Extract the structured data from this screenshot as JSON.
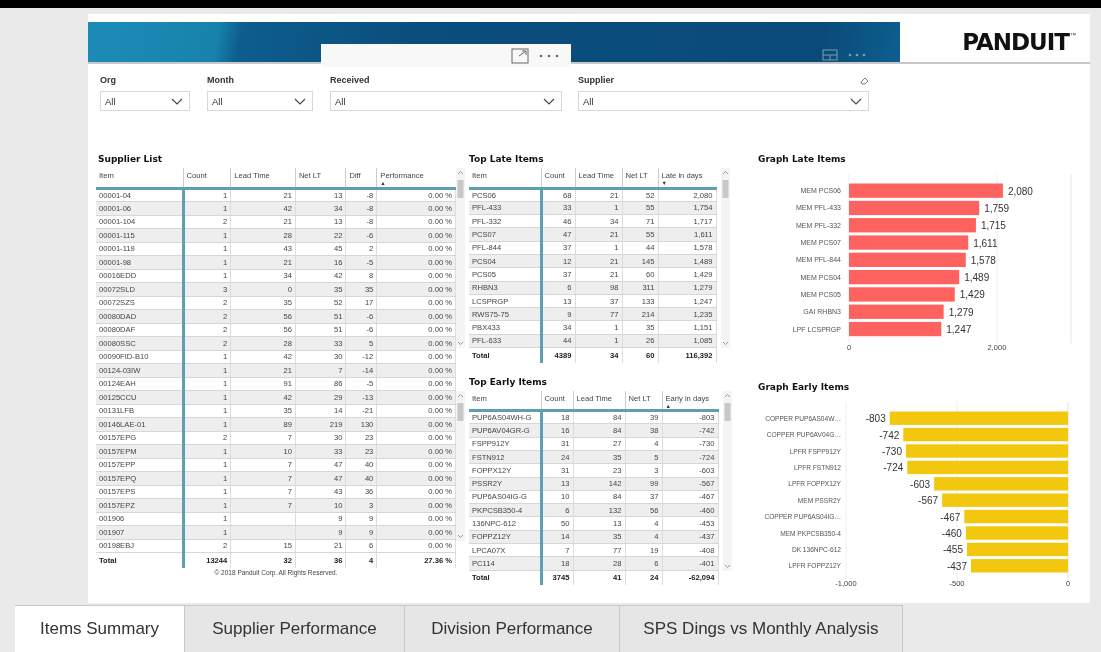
{
  "logo": "PANDUIT",
  "logo_mark": "™",
  "filters": [
    {
      "label": "Org",
      "value": "All"
    },
    {
      "label": "Month",
      "value": "All"
    },
    {
      "label": "Received",
      "value": "All"
    },
    {
      "label": "Supplier",
      "value": "All",
      "eraser": true
    }
  ],
  "supplier_list": {
    "title": "Supplier List",
    "columns": [
      {
        "label": "Item"
      },
      {
        "label": "Count"
      },
      {
        "label": "Lead Time"
      },
      {
        "label": "Net LT"
      },
      {
        "label": "Diff"
      },
      {
        "label": "Performance",
        "sort_arrow": "▲"
      }
    ],
    "rows": [
      [
        "00001-04",
        "1",
        "21",
        "13",
        "-8",
        "0.00 %"
      ],
      [
        "00001-06",
        "1",
        "42",
        "34",
        "-8",
        "0.00 %"
      ],
      [
        "00001-104",
        "2",
        "21",
        "13",
        "-8",
        "0.00 %"
      ],
      [
        "00001-115",
        "1",
        "28",
        "22",
        "-6",
        "0.00 %"
      ],
      [
        "00001-119",
        "1",
        "43",
        "45",
        "2",
        "0.00 %"
      ],
      [
        "00001-98",
        "1",
        "21",
        "16",
        "-5",
        "0.00 %"
      ],
      [
        "00016EDD",
        "1",
        "34",
        "42",
        "8",
        "0.00 %"
      ],
      [
        "00072SLD",
        "3",
        "0",
        "35",
        "35",
        "0.00 %"
      ],
      [
        "00072SZS",
        "2",
        "35",
        "52",
        "17",
        "0.00 %"
      ],
      [
        "00080DAD",
        "2",
        "56",
        "51",
        "-6",
        "0.00 %"
      ],
      [
        "00080DAF",
        "2",
        "56",
        "51",
        "-6",
        "0.00 %"
      ],
      [
        "00080SSC",
        "2",
        "28",
        "33",
        "5",
        "0.00 %"
      ],
      [
        "00090FID-B10",
        "1",
        "42",
        "30",
        "-12",
        "0.00 %"
      ],
      [
        "00124-03IW",
        "1",
        "21",
        "7",
        "-14",
        "0.00 %"
      ],
      [
        "00124EAH",
        "1",
        "91",
        "86",
        "-5",
        "0.00 %"
      ],
      [
        "00125CCU",
        "1",
        "42",
        "29",
        "-13",
        "0.00 %"
      ],
      [
        "00131LFB",
        "1",
        "35",
        "14",
        "-21",
        "0.00 %"
      ],
      [
        "00146LAE-01",
        "1",
        "89",
        "219",
        "130",
        "0.00 %"
      ],
      [
        "00157EPG",
        "2",
        "7",
        "30",
        "23",
        "0.00 %"
      ],
      [
        "00157EPM",
        "1",
        "10",
        "33",
        "23",
        "0.00 %"
      ],
      [
        "00157EPP",
        "1",
        "7",
        "47",
        "40",
        "0.00 %"
      ],
      [
        "00157EPQ",
        "1",
        "7",
        "47",
        "40",
        "0.00 %"
      ],
      [
        "00157EPS",
        "1",
        "7",
        "43",
        "36",
        "0.00 %"
      ],
      [
        "00157EPZ",
        "1",
        "7",
        "10",
        "3",
        "0.00 %"
      ],
      [
        "001906",
        "1",
        "",
        "9",
        "9",
        "0.00 %"
      ],
      [
        "001907",
        "1",
        "",
        "9",
        "9",
        "0.00 %"
      ],
      [
        "00198EBJ",
        "2",
        "15",
        "21",
        "6",
        "0.00 %"
      ]
    ],
    "total": [
      "Total",
      "13244",
      "32",
      "36",
      "4",
      "27.36 %"
    ]
  },
  "footer": "© 2018 Panduit Corp.  All Rights Reserved.",
  "top_late": {
    "title": "Top Late Items",
    "columns": [
      {
        "label": "Item"
      },
      {
        "label": "Count"
      },
      {
        "label": "Lead Time"
      },
      {
        "label": "Net LT"
      },
      {
        "label": "Late in days",
        "sort_arrow": "▼"
      }
    ],
    "rows": [
      [
        "PCS06",
        "68",
        "21",
        "52",
        "2,080"
      ],
      [
        "PFL-433",
        "33",
        "1",
        "55",
        "1,754"
      ],
      [
        "PFL-332",
        "46",
        "34",
        "71",
        "1,717"
      ],
      [
        "PCS07",
        "47",
        "21",
        "55",
        "1,611"
      ],
      [
        "PFL-844",
        "37",
        "1",
        "44",
        "1,578"
      ],
      [
        "PCS04",
        "12",
        "21",
        "145",
        "1,489"
      ],
      [
        "PCS05",
        "37",
        "21",
        "60",
        "1,429"
      ],
      [
        "RHBN3",
        "6",
        "98",
        "311",
        "1,279"
      ],
      [
        "LCSPRGP",
        "13",
        "37",
        "133",
        "1,247"
      ],
      [
        "RWS75-75",
        "9",
        "77",
        "214",
        "1,235"
      ],
      [
        "PBX433",
        "34",
        "1",
        "35",
        "1,151"
      ],
      [
        "PFL-633",
        "44",
        "1",
        "26",
        "1,085"
      ]
    ],
    "total": [
      "Total",
      "4389",
      "34",
      "60",
      "116,392"
    ]
  },
  "top_early": {
    "title": "Top Early Items",
    "columns": [
      {
        "label": "Item"
      },
      {
        "label": "Count"
      },
      {
        "label": "Lead Time"
      },
      {
        "label": "Net LT"
      },
      {
        "label": "Early in days",
        "sort_arrow": "▲"
      }
    ],
    "rows": [
      [
        "PUP6AS04WH-G",
        "18",
        "84",
        "39",
        "-803"
      ],
      [
        "PUP6AV04GR-G",
        "16",
        "84",
        "38",
        "-742"
      ],
      [
        "FSPP912Y",
        "31",
        "27",
        "4",
        "-730"
      ],
      [
        "FSTN912",
        "24",
        "35",
        "5",
        "-724"
      ],
      [
        "FOPPX12Y",
        "31",
        "23",
        "3",
        "-603"
      ],
      [
        "PSSR2Y",
        "13",
        "142",
        "99",
        "-567"
      ],
      [
        "PUP6AS04IG-G",
        "10",
        "84",
        "37",
        "-467"
      ],
      [
        "PKPCSB350-4",
        "6",
        "132",
        "56",
        "-460"
      ],
      [
        "136NPC-612",
        "50",
        "13",
        "4",
        "-453"
      ],
      [
        "FOPPZ12Y",
        "14",
        "35",
        "4",
        "-437"
      ],
      [
        "LPCA07X",
        "7",
        "77",
        "19",
        "-408"
      ],
      [
        "PC114",
        "18",
        "28",
        "6",
        "-401"
      ]
    ],
    "total": [
      "Total",
      "3745",
      "41",
      "24",
      "-62,094"
    ]
  },
  "graph_late": {
    "title": "Graph Late Items",
    "chart_data": {
      "type": "bar",
      "orientation": "horizontal",
      "categories": [
        "MEM PCS06",
        "MEM PFL-433",
        "MEM PFL-332",
        "MEM PCS07",
        "MEM PFL-844",
        "MEM PCS04",
        "MEM PCS05",
        "GAI RHBN3",
        "LPF LCSPRGP"
      ],
      "series": [
        {
          "color": "#fd625e",
          "values": [
            2080,
            1759,
            1715,
            1611,
            1578,
            1489,
            1429,
            1279,
            1247
          ]
        }
      ],
      "value_labels": [
        "2,080",
        "1,759",
        "1,715",
        "1,611",
        "1,578",
        "1,489",
        "1,429",
        "1,279",
        "1,247"
      ],
      "xlim": [
        0,
        3000
      ],
      "xticks": [
        {
          "value": 0,
          "label": "0"
        },
        {
          "value": 2000,
          "label": "2,000"
        }
      ]
    }
  },
  "graph_early": {
    "title": "Graph Early Items",
    "chart_data": {
      "type": "bar",
      "orientation": "horizontal",
      "categories": [
        "COPPER PUP6AS04W…",
        "COPPER PUP6AV04G…",
        "LPFR FSPP912Y",
        "LPFR FSTN912",
        "LPFR FOPPX12Y",
        "MEM PSSR2Y",
        "COPPER PUP6AS04IG…",
        "MEM PKPCSB350-4",
        "DK 136NPC-612",
        "LPFR FOPPZ12Y"
      ],
      "series": [
        {
          "color": "#f2c80f",
          "values": [
            -803,
            -742,
            -730,
            -724,
            -603,
            -567,
            -467,
            -460,
            -455,
            -437
          ]
        }
      ],
      "value_labels": [
        "-803",
        "-742",
        "-730",
        "-724",
        "-603",
        "-567",
        "-467",
        "-460",
        "-455",
        "-437"
      ],
      "xlim": [
        -1000,
        0
      ],
      "xticks": [
        {
          "value": -1000,
          "label": "-1,000"
        },
        {
          "value": -500,
          "label": "-500"
        },
        {
          "value": 0,
          "label": "0"
        }
      ]
    }
  },
  "tabs": [
    {
      "label": "Items Summary",
      "selected": true
    },
    {
      "label": "Supplier Performance",
      "selected": false
    },
    {
      "label": "Division Performance",
      "selected": false
    },
    {
      "label": "SPS Dings vs Monthly Analysis",
      "selected": false
    }
  ]
}
